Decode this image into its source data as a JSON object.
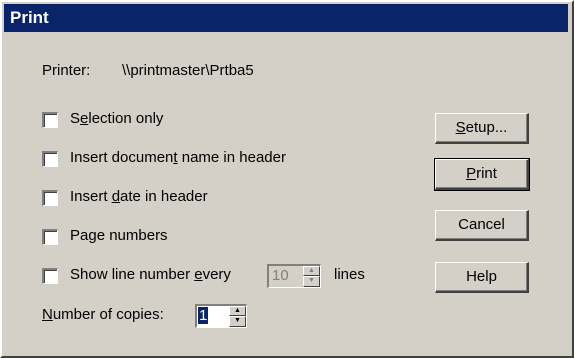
{
  "dialog": {
    "title": "Print",
    "printer_label": "Printer:",
    "printer_value": "\\\\printmaster\\Prtba5"
  },
  "options": {
    "selection_only": {
      "pre": "S",
      "u": "e",
      "post": "lection only",
      "checked": false
    },
    "doc_name": {
      "pre": "Insert documen",
      "u": "t",
      "post": " name in header",
      "checked": false
    },
    "date": {
      "pre": "Insert ",
      "u": "d",
      "post": "ate in header",
      "checked": false
    },
    "page_numbers": {
      "pre": "Page numbers",
      "u": "",
      "post": "",
      "checked": false
    },
    "line_numbers": {
      "pre": "Show line number ",
      "u": "e",
      "post": "very",
      "checked": false
    },
    "line_interval": "10",
    "lines_label": "lines"
  },
  "copies": {
    "pre": "",
    "u": "N",
    "post": "umber of copies:",
    "value": "1"
  },
  "buttons": {
    "setup": {
      "pre": "",
      "u": "S",
      "post": "etup..."
    },
    "print": {
      "pre": "",
      "u": "P",
      "post": "rint"
    },
    "cancel": {
      "pre": "Cancel",
      "u": "",
      "post": ""
    },
    "help": {
      "pre": "Help",
      "u": "",
      "post": ""
    }
  },
  "icons": {
    "spin_up": "spin-up-arrow-icon",
    "spin_down": "spin-down-arrow-icon"
  }
}
